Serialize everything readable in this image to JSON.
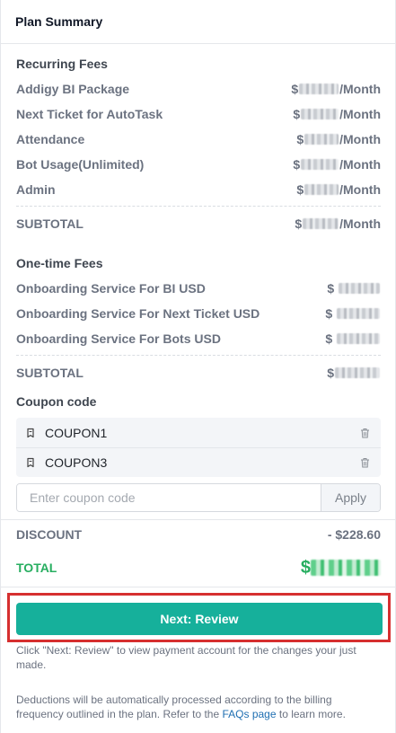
{
  "header": {
    "title": "Plan Summary"
  },
  "recurring": {
    "title": "Recurring Fees",
    "currency": "$",
    "period": "/Month",
    "items": [
      {
        "label": "Addigy BI Package"
      },
      {
        "label": "Next Ticket for AutoTask"
      },
      {
        "label": "Attendance"
      },
      {
        "label": "Bot Usage(Unlimited)"
      },
      {
        "label": "Admin"
      }
    ],
    "subtotal_label": "SUBTOTAL"
  },
  "onetime": {
    "title": "One-time Fees",
    "currency": "$",
    "items": [
      {
        "label": "Onboarding Service For BI USD"
      },
      {
        "label": "Onboarding Service For Next Ticket USD"
      },
      {
        "label": "Onboarding Service For Bots USD"
      }
    ],
    "subtotal_label": "SUBTOTAL",
    "subtotal_currency": "$"
  },
  "coupon": {
    "title": "Coupon code",
    "applied": [
      "COUPON1",
      "COUPON3"
    ],
    "input_placeholder": "Enter coupon code",
    "input_value": "",
    "apply_label": "Apply"
  },
  "summary": {
    "discount_label": "DISCOUNT",
    "discount_value": "- $228.60",
    "total_label": "TOTAL",
    "total_currency": "$"
  },
  "actions": {
    "next_label": "Next: Review"
  },
  "notes": {
    "hint": "Click \"Next: Review\" to view payment account for the changes your just made.",
    "deductions_prefix": "Deductions will be automatically processed according to the billing frequency outlined in the plan. Refer to the ",
    "faq_link": "FAQs page",
    "deductions_suffix": " to learn more."
  },
  "colors": {
    "accent": "#16b09b",
    "total_green": "#27ae60",
    "link": "#1f6fb2",
    "highlight_red": "#d62f2f"
  },
  "icons": {
    "coupon": "coupon-tag-icon",
    "delete": "trash-icon"
  }
}
